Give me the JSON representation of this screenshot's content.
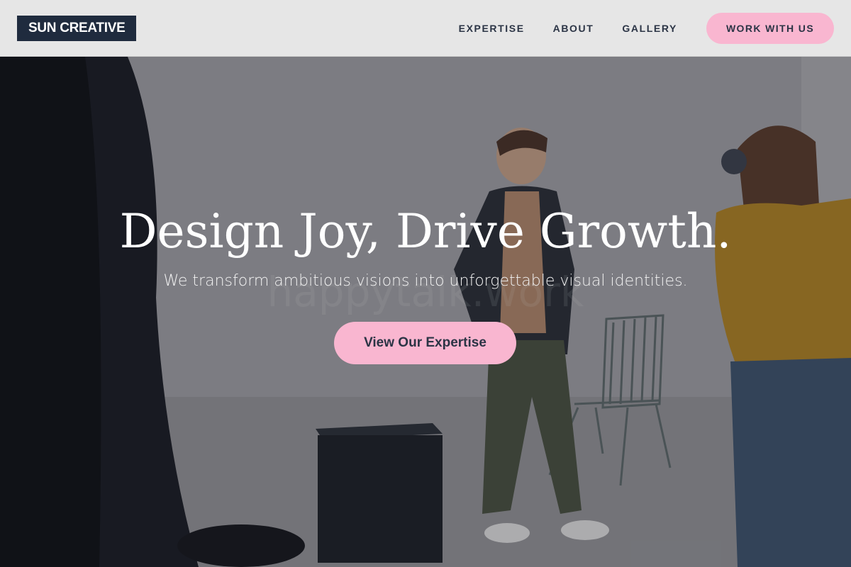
{
  "brand": {
    "logo_text": "SUN CREATIVE"
  },
  "nav": {
    "links": [
      {
        "label": "EXPERTISE"
      },
      {
        "label": "ABOUT"
      },
      {
        "label": "GALLERY"
      }
    ],
    "cta_label": "WORK WITH US"
  },
  "hero": {
    "headline": "Design Joy, Drive Growth.",
    "subheadline": "We transform ambitious visions into unforgettable visual identities.",
    "button_label": "View Our Expertise"
  },
  "colors": {
    "accent_pink": "#f9b6d0",
    "logo_navy": "#1f2b3e",
    "nav_background": "#e6e6e6",
    "nav_text": "#2b3445"
  }
}
